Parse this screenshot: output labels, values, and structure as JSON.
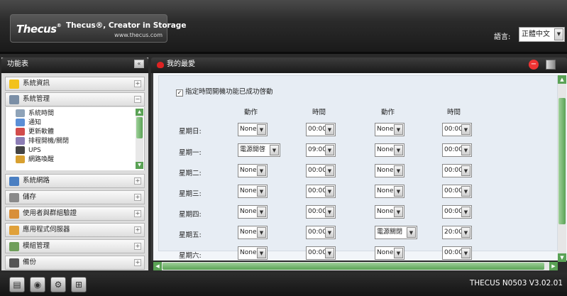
{
  "header": {
    "logo": "Thecus",
    "tagline": "Thecus®, Creator in Storage",
    "url": "www.thecus.com",
    "language_label": "語言:",
    "language_value": "正體中文"
  },
  "sidebar": {
    "title": "功能表",
    "collapse_icon": "double-chevron-left-icon",
    "categories": [
      {
        "label": "系統資訊",
        "icon": "info-icon"
      },
      {
        "label": "系統管理",
        "icon": "tools-icon"
      },
      {
        "label": "系統網路",
        "icon": "network-icon"
      },
      {
        "label": "儲存",
        "icon": "storage-icon"
      },
      {
        "label": "使用者與群組驗證",
        "icon": "users-icon"
      },
      {
        "label": "應用程式伺服器",
        "icon": "app-server-icon"
      },
      {
        "label": "模組管理",
        "icon": "module-icon"
      },
      {
        "label": "備份",
        "icon": "backup-icon"
      }
    ],
    "sub_items": [
      {
        "label": "系統時間",
        "icon": "clock-icon"
      },
      {
        "label": "通知",
        "icon": "notify-icon"
      },
      {
        "label": "更新軟體",
        "icon": "update-icon"
      },
      {
        "label": "排程開機/關閉",
        "icon": "schedule-icon"
      },
      {
        "label": "UPS",
        "icon": "ups-icon"
      },
      {
        "label": "網路喚醒",
        "icon": "wol-icon"
      }
    ]
  },
  "main": {
    "title": "我的最愛",
    "checkbox_label": "指定時間開機功能已成功啓動",
    "checkbox_checked": true,
    "columns": [
      "動作",
      "時間",
      "動作",
      "時間"
    ],
    "rows": [
      {
        "day": "星期日:",
        "action1": "None",
        "time1": "00:00",
        "action2": "None",
        "time2": "00:00"
      },
      {
        "day": "星期一:",
        "action1": "電源開啓",
        "time1": "09:00",
        "action2": "None",
        "time2": "00:00"
      },
      {
        "day": "星期二:",
        "action1": "None",
        "time1": "00:00",
        "action2": "None",
        "time2": "00:00"
      },
      {
        "day": "星期三:",
        "action1": "None",
        "time1": "00:00",
        "action2": "None",
        "time2": "00:00"
      },
      {
        "day": "星期四:",
        "action1": "None",
        "time1": "00:00",
        "action2": "None",
        "time2": "00:00"
      },
      {
        "day": "星期五:",
        "action1": "None",
        "time1": "00:00",
        "action2": "電源關閉",
        "time2": "20:00"
      },
      {
        "day": "星期六:",
        "action1": "None",
        "time1": "00:00",
        "action2": "None",
        "time2": "00:00"
      }
    ]
  },
  "footer": {
    "version": "THECUS N0503 V3.02.01",
    "icons": [
      "status-icon",
      "disk-icon",
      "settings-icon",
      "network-map-icon"
    ]
  },
  "colors": {
    "accent_green": "#5aa255",
    "header_dark": "#1a1a1a"
  }
}
